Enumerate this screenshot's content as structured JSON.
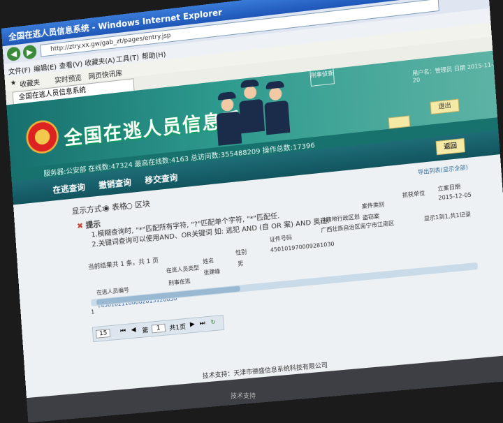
{
  "window": {
    "title": "全国在逃人员信息系统 - Windows Internet Explorer"
  },
  "menu": [
    "文件(F)",
    "编辑(E)",
    "查看(V)",
    "收藏夹(A)",
    "工具(T)",
    "帮助(H)"
  ],
  "favorites": {
    "label": "收藏夹",
    "items": [
      "实时预览",
      "网页快讯库"
    ]
  },
  "tab": {
    "label": "全国在逃人员信息系统"
  },
  "banner": {
    "system_title": "全国在逃人员信息系统",
    "badge_text": "刑事侦查",
    "user_info": "用户名：管理员 日期 2015-11-20"
  },
  "stats": {
    "text": "服务器:公安部  在线数:47324  最高在线数:4163  总访问数:355488209  操作总数:17396"
  },
  "nav": {
    "items": [
      "在逃查询",
      "撤销查询",
      "移交查询"
    ],
    "logout": "退出",
    "back": "返回"
  },
  "display": {
    "label": "显示方式:",
    "option_table": "表格",
    "option_block": "区块"
  },
  "tips": {
    "title": "提示",
    "lines": [
      "1.模糊查询时, \"*\"匹配所有字符, \"?\"匹配单个字符, \"*\"匹配任.",
      "2.关键词查询可以使用AND、OR关键词 如: 逃犯 AND (自 OR 案) AND 奥迪."
    ]
  },
  "result": {
    "summary": "当前结果共 1 条，共 1 页",
    "export_link": "导出列表(显示全部)",
    "right_note": "显示1到1,共1记录"
  },
  "table": {
    "headers": [
      "在逃人员编号",
      "在逃人员类型",
      "姓名",
      "性别",
      "证件号码",
      "户籍地行政区划",
      "案件类别",
      "抓获单位",
      "立案日期"
    ],
    "row": {
      "index": "1",
      "id": "T4501021100002015120050",
      "type": "刑事在逃",
      "name": "张建峰",
      "sex": "男",
      "idcard": "450101970009281030",
      "region": "广西壮族自治区南宁市江南区",
      "case": "盗窃案",
      "date": "2015-12-05"
    }
  },
  "pager": {
    "page_size": "15",
    "page_label": "第",
    "page_value": "1",
    "total": "共1页"
  },
  "footer": {
    "text": "技术支持：天津市德盛信息系统科技有限公司",
    "bottom": "技术支持"
  }
}
